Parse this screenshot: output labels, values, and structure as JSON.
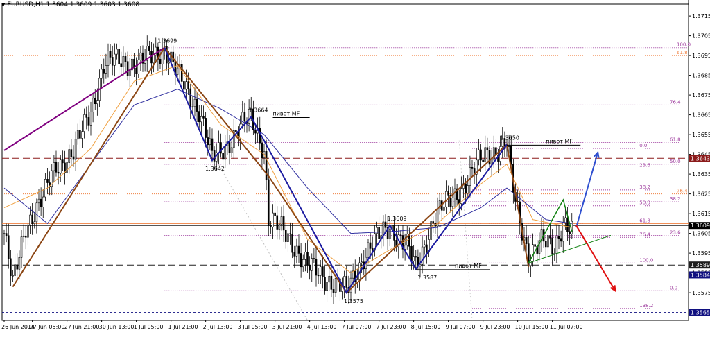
{
  "title": {
    "symbol": "EURUSD,H1",
    "ohlc": "1.3604 1.3609 1.3603 1.3608"
  },
  "colors": {
    "background": "#ffffff",
    "bull_candle": "#000000",
    "bear_candle": "#000000",
    "ma_fast": "#f0a040",
    "ma_slow": "#3030a0",
    "wave_brown": "#8b4513",
    "wave_blue": "#1a1aa0",
    "wave_purple": "#800080",
    "wave_green": "#108010",
    "arrow_up": "#3050d0",
    "arrow_down": "#e01010",
    "fib_purple": "#a040a0",
    "fib_orange": "#f08040",
    "level_dark": "#202020",
    "level_red": "#8b1a1a",
    "level_navy": "#101080"
  },
  "chart_data": {
    "type": "candlestick",
    "ylim": [
      1.3561,
      1.3721
    ],
    "y_ticks": [
      "1.3575",
      "1.3585",
      "1.3595",
      "1.3605",
      "1.3615",
      "1.3625",
      "1.3635",
      "1.3645",
      "1.3655",
      "1.3665",
      "1.3675",
      "1.3685",
      "1.3695",
      "1.3705",
      "1.3715"
    ],
    "x_ticks": [
      {
        "label": "26 Jun 2014",
        "i": 0
      },
      {
        "label": "27 Jun 05:00",
        "i": 13
      },
      {
        "label": "27 Jun 21:00",
        "i": 29
      },
      {
        "label": "30 Jun 13:00",
        "i": 45
      },
      {
        "label": "1 Jul 05:00",
        "i": 61
      },
      {
        "label": "1 Jul 21:00",
        "i": 77
      },
      {
        "label": "2 Jul 13:00",
        "i": 93
      },
      {
        "label": "3 Jul 05:00",
        "i": 109
      },
      {
        "label": "3 Jul 21:00",
        "i": 125
      },
      {
        "label": "4 Jul 13:00",
        "i": 141
      },
      {
        "label": "7 Jul 07:00",
        "i": 157
      },
      {
        "label": "7 Jul 23:00",
        "i": 173
      },
      {
        "label": "8 Jul 15:00",
        "i": 189
      },
      {
        "label": "9 Jul 07:00",
        "i": 205
      },
      {
        "label": "9 Jul 23:00",
        "i": 221
      },
      {
        "label": "10 Jul 15:00",
        "i": 237
      },
      {
        "label": "11 Jul 07:00",
        "i": 253
      }
    ],
    "price_anchors": [
      [
        0,
        1.3605
      ],
      [
        4,
        1.3578
      ],
      [
        10,
        1.361
      ],
      [
        18,
        1.3622
      ],
      [
        24,
        1.364
      ],
      [
        32,
        1.3645
      ],
      [
        40,
        1.3668
      ],
      [
        46,
        1.369
      ],
      [
        54,
        1.3693
      ],
      [
        62,
        1.369
      ],
      [
        74,
        1.3699
      ],
      [
        80,
        1.3685
      ],
      [
        90,
        1.3668
      ],
      [
        96,
        1.3642
      ],
      [
        104,
        1.3652
      ],
      [
        114,
        1.3664
      ],
      [
        120,
        1.3648
      ],
      [
        122,
        1.3612
      ],
      [
        132,
        1.3603
      ],
      [
        140,
        1.3588
      ],
      [
        150,
        1.3582
      ],
      [
        158,
        1.3575
      ],
      [
        166,
        1.3594
      ],
      [
        174,
        1.3604
      ],
      [
        178,
        1.3609
      ],
      [
        186,
        1.3598
      ],
      [
        190,
        1.3587
      ],
      [
        198,
        1.3612
      ],
      [
        206,
        1.3622
      ],
      [
        214,
        1.3632
      ],
      [
        222,
        1.3645
      ],
      [
        232,
        1.365
      ],
      [
        236,
        1.362
      ],
      [
        242,
        1.3595
      ],
      [
        248,
        1.36
      ],
      [
        254,
        1.3598
      ],
      [
        258,
        1.3612
      ],
      [
        262,
        1.3606
      ]
    ],
    "n_candles": 263,
    "ma_fast_anchors": [
      [
        0,
        1.3618
      ],
      [
        20,
        1.3628
      ],
      [
        40,
        1.3648
      ],
      [
        60,
        1.3682
      ],
      [
        80,
        1.369
      ],
      [
        100,
        1.366
      ],
      [
        120,
        1.3645
      ],
      [
        140,
        1.3602
      ],
      [
        160,
        1.3585
      ],
      [
        180,
        1.3598
      ],
      [
        200,
        1.361
      ],
      [
        220,
        1.363
      ],
      [
        232,
        1.364
      ],
      [
        244,
        1.3612
      ],
      [
        262,
        1.3608
      ]
    ],
    "ma_slow_anchors": [
      [
        0,
        1.3628
      ],
      [
        20,
        1.361
      ],
      [
        40,
        1.364
      ],
      [
        60,
        1.367
      ],
      [
        80,
        1.3678
      ],
      [
        100,
        1.3668
      ],
      [
        120,
        1.3655
      ],
      [
        140,
        1.3628
      ],
      [
        160,
        1.3605
      ],
      [
        180,
        1.3606
      ],
      [
        200,
        1.3608
      ],
      [
        220,
        1.3618
      ],
      [
        232,
        1.3628
      ],
      [
        250,
        1.3612
      ],
      [
        262,
        1.361
      ]
    ],
    "wave_lines": [
      {
        "color": "wave_purple",
        "width": 2,
        "points": [
          [
            0,
            1.3647
          ],
          [
            74,
            1.3699
          ]
        ]
      },
      {
        "color": "wave_brown",
        "width": 2,
        "points": [
          [
            4,
            1.3578
          ],
          [
            74,
            1.3699
          ],
          [
            122,
            1.3634
          ],
          [
            158,
            1.3575
          ],
          [
            232,
            1.365
          ],
          [
            242,
            1.3588
          ]
        ]
      },
      {
        "color": "wave_blue",
        "width": 2,
        "points": [
          [
            74,
            1.3699
          ],
          [
            96,
            1.3642
          ],
          [
            114,
            1.3664
          ],
          [
            158,
            1.3575
          ],
          [
            178,
            1.3609
          ],
          [
            190,
            1.3587
          ],
          [
            232,
            1.365
          ]
        ]
      },
      {
        "color": "wave_green",
        "width": 1.5,
        "points": [
          [
            242,
            1.359
          ],
          [
            252,
            1.361
          ],
          [
            258,
            1.3622
          ],
          [
            262,
            1.3606
          ]
        ]
      }
    ],
    "trend_line": {
      "color": "wave_green",
      "points": [
        [
          242,
          1.359
        ],
        [
          280,
          1.3604
        ]
      ]
    },
    "arrows": [
      {
        "color": "arrow_up",
        "from": [
          264,
          1.3608
        ],
        "to": [
          274,
          1.3646
        ]
      },
      {
        "color": "arrow_down",
        "from": [
          264,
          1.3609
        ],
        "to": [
          282,
          1.3576
        ]
      }
    ],
    "price_labels": [
      {
        "text": "1.3699",
        "i": 74,
        "price": 1.3699,
        "pos": "above"
      },
      {
        "text": "1.3664",
        "i": 116,
        "price": 1.3664,
        "pos": "above"
      },
      {
        "text": "1.3642",
        "i": 96,
        "price": 1.3642,
        "pos": "below"
      },
      {
        "text": "1.3650",
        "i": 232,
        "price": 1.365,
        "pos": "above"
      },
      {
        "text": "1.3609",
        "i": 180,
        "price": 1.3609,
        "pos": "above"
      },
      {
        "text": "1.3587",
        "i": 194,
        "price": 1.3587,
        "pos": "below"
      },
      {
        "text": "1.3575",
        "i": 160,
        "price": 1.3575,
        "pos": "below"
      }
    ],
    "pivot_labels": [
      {
        "text": "пивот MF",
        "i": 124,
        "price": 1.3664,
        "line_to": 141
      },
      {
        "text": "пивот MF",
        "i": 208,
        "price": 1.3587,
        "line_to": 224,
        "line_from": 190
      },
      {
        "text": "пивот MF",
        "i": 250,
        "price": 1.365,
        "line_to": 266,
        "line_from": 232
      }
    ],
    "fib_levels": [
      {
        "price": 1.3699,
        "label": "100.0",
        "from": 74,
        "to": 322,
        "color": "fib_purple"
      },
      {
        "price": 1.3695,
        "label": "61.8",
        "from": 0,
        "to": 322,
        "color": "fib_orange"
      },
      {
        "price": 1.367,
        "label": "76.4",
        "from": 74,
        "to": 312,
        "color": "fib_purple"
      },
      {
        "price": 1.3651,
        "label": "61.8",
        "from": 74,
        "to": 312,
        "color": "fib_purple"
      },
      {
        "price": 1.3648,
        "label": "0.0",
        "from": 216,
        "to": 298,
        "color": "fib_purple"
      },
      {
        "price": 1.364,
        "label": "50.0",
        "from": 74,
        "to": 312,
        "color": "fib_purple"
      },
      {
        "price": 1.3638,
        "label": "23.6",
        "from": 216,
        "to": 298,
        "color": "fib_purple"
      },
      {
        "price": 1.3627,
        "label": "38.2",
        "from": 216,
        "to": 298,
        "color": "fib_purple"
      },
      {
        "price": 1.3625,
        "label": "76.4",
        "from": 0,
        "to": 322,
        "color": "fib_orange"
      },
      {
        "price": 1.3621,
        "label": "38.2",
        "from": 74,
        "to": 312,
        "color": "fib_purple"
      },
      {
        "price": 1.3619,
        "label": "50.0",
        "from": 216,
        "to": 298,
        "color": "fib_purple"
      },
      {
        "price": 1.361,
        "label": "61.8",
        "from": 216,
        "to": 298,
        "color": "fib_purple"
      },
      {
        "price": 1.3604,
        "label": "23.6",
        "from": 74,
        "to": 312,
        "color": "fib_purple"
      },
      {
        "price": 1.3603,
        "label": "76.4",
        "from": 216,
        "to": 298,
        "color": "fib_purple"
      },
      {
        "price": 1.359,
        "label": "100.0",
        "from": 216,
        "to": 298,
        "color": "fib_purple"
      },
      {
        "price": 1.3576,
        "label": "0.0",
        "from": 74,
        "to": 312,
        "color": "fib_purple"
      },
      {
        "price": 1.3567,
        "label": "138.2",
        "from": 216,
        "to": 298,
        "color": "fib_purple"
      }
    ],
    "h_levels": [
      {
        "price": 1.3643,
        "color": "level_red",
        "dash": "10,5",
        "tag": "1.3643",
        "tag_bg": "#8b1a1a"
      },
      {
        "price": 1.361,
        "color": "fib_orange",
        "dash": "",
        "tag": "",
        "tag_bg": ""
      },
      {
        "price": 1.3609,
        "color": "level_dark",
        "dash": "",
        "tag": "1.3609",
        "tag_bg": "#000000"
      },
      {
        "price": 1.3589,
        "color": "level_dark",
        "dash": "10,5",
        "tag": "1.3589",
        "tag_bg": "#202020"
      },
      {
        "price": 1.3584,
        "color": "level_navy",
        "dash": "10,5",
        "tag": "1.3584",
        "tag_bg": "#101080"
      },
      {
        "price": 1.3565,
        "color": "level_navy",
        "dash": "3,3",
        "tag": "1.3565",
        "tag_bg": "#101080"
      }
    ],
    "v_lines": [
      {
        "from": [
          88,
          1.3661
        ],
        "to": [
          140,
          1.3561
        ],
        "color": "#c0c0c0"
      },
      {
        "from": [
          210,
          1.3652
        ],
        "to": [
          216,
          1.3561
        ],
        "color": "#d0d0d0"
      }
    ]
  }
}
